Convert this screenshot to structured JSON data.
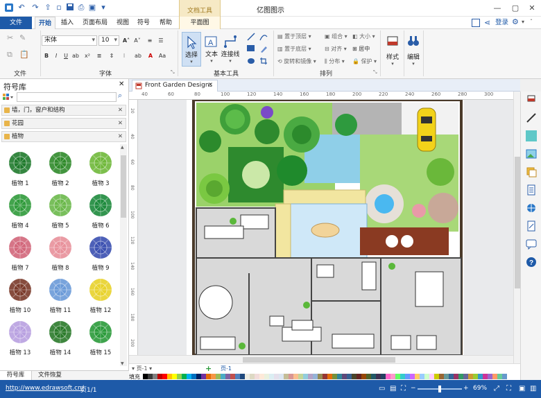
{
  "app": {
    "title": "亿图图示",
    "context_tab_header": "文档工具"
  },
  "menubar": {
    "file": "文件",
    "tabs": [
      "开始",
      "插入",
      "页面布局",
      "视图",
      "符号",
      "帮助"
    ],
    "context_tab": "平面图",
    "login": "登录"
  },
  "ribbon": {
    "font_name": "宋体",
    "font_size": "10",
    "groups": {
      "file": "文件",
      "font": "字体",
      "basic_tools": "基本工具",
      "arrange": "排列"
    },
    "tools": {
      "select": "选择",
      "text": "文本",
      "connector": "连接线"
    },
    "arrange_items": [
      "置于顶层",
      "组合",
      "大小",
      "置于底层",
      "对齐",
      "居中",
      "旋转和镜像",
      "分布",
      "保护"
    ],
    "style": "样式",
    "edit": "编辑"
  },
  "library": {
    "title": "符号库",
    "search_placeholder": "",
    "categories": [
      "墙，门，窗户和结构",
      "花园",
      "植物"
    ],
    "shapes": [
      {
        "label": "植物 1",
        "color": "#1f7a2c"
      },
      {
        "label": "植物 2",
        "color": "#2f8a2a"
      },
      {
        "label": "植物 3",
        "color": "#6fb83a"
      },
      {
        "label": "植物 4",
        "color": "#2f9a3a"
      },
      {
        "label": "植物 5",
        "color": "#6ab84a"
      },
      {
        "label": "植物 6",
        "color": "#1d8a3c"
      },
      {
        "label": "植物 7",
        "color": "#d2667a"
      },
      {
        "label": "植物 8",
        "color": "#e8909a"
      },
      {
        "label": "植物 9",
        "color": "#3a4fb0"
      },
      {
        "label": "植物 10",
        "color": "#7a3a2a"
      },
      {
        "label": "植物 11",
        "color": "#6a9ad8"
      },
      {
        "label": "植物 12",
        "color": "#e8d22a"
      },
      {
        "label": "植物 13",
        "color": "#b8a0e0"
      },
      {
        "label": "植物 14",
        "color": "#2a7a2a"
      },
      {
        "label": "植物 15",
        "color": "#2a9a3a"
      }
    ]
  },
  "bottom_tabs": [
    "符号库",
    "文件恢复"
  ],
  "document": {
    "tab_title": "Front Garden Designs",
    "page_selector": "页-1",
    "page_tab": "页-1",
    "fill_label": "填充"
  },
  "ruler": {
    "h_ticks": [
      "40",
      "60",
      "80",
      "100",
      "120",
      "140",
      "160",
      "180",
      "200",
      "220",
      "240",
      "260",
      "280",
      "300"
    ],
    "v_ticks": [
      "20",
      "40",
      "60",
      "80",
      "100",
      "120",
      "140",
      "160",
      "180",
      "200"
    ]
  },
  "status": {
    "url": "http://www.edrawsoft.cn/",
    "page": "页1/1",
    "zoom": "69%"
  },
  "colors": {
    "brand": "#1e5aa8",
    "palette": [
      "#000000",
      "#3a3a3a",
      "#7f7f7f",
      "#c00000",
      "#ff0000",
      "#ffc000",
      "#ffff00",
      "#92d050",
      "#00b050",
      "#00b0f0",
      "#0070c0",
      "#002060",
      "#7030a0",
      "#e26b0a",
      "#f79646",
      "#9bbb59",
      "#4bacc6",
      "#8064a2",
      "#c0504d",
      "#4f81bd",
      "#1f497d",
      "#eeece1",
      "#ddd9c4",
      "#f2dcdb",
      "#fde9d9",
      "#ebf1de",
      "#dbeef3",
      "#e5e0ec",
      "#dce6f1",
      "#c4bd97",
      "#d99694",
      "#fabf8f",
      "#c2d69a",
      "#93cddd",
      "#b3a2c7",
      "#95b3d7",
      "#948a54",
      "#963634",
      "#e46d0a",
      "#76923c",
      "#31869b",
      "#5f497a",
      "#366092",
      "#4a452a",
      "#632523",
      "#974706",
      "#4f6228",
      "#215967",
      "#3f3151",
      "#244062",
      "#ff66cc",
      "#ff99cc",
      "#66ff66",
      "#33cccc",
      "#6699ff",
      "#cc66ff",
      "#ffcc66",
      "#99ccff",
      "#ccffcc",
      "#ffccff",
      "#cccc00",
      "#996633",
      "#669999",
      "#336699",
      "#993366",
      "#339966",
      "#666699",
      "#cc9933",
      "#99cc33",
      "#3399cc",
      "#cc3399",
      "#9966cc",
      "#ff9966",
      "#66cc99",
      "#6699cc"
    ]
  }
}
